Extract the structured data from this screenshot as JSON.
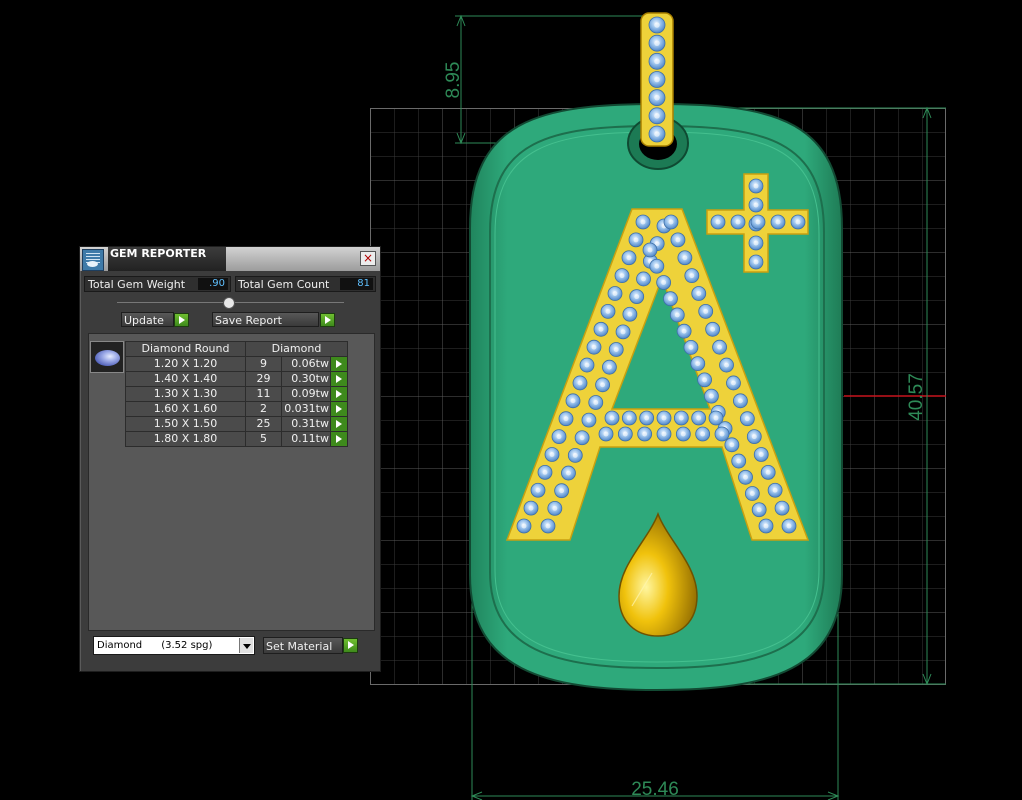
{
  "dimensions": {
    "top_height": "8.95",
    "right_height": "40.57",
    "bottom_width": "25.46"
  },
  "panel": {
    "title": "GEM REPORTER",
    "close_label": "×",
    "total_weight_label": "Total Gem Weight",
    "total_weight_value": ".90",
    "total_count_label": "Total Gem Count",
    "total_count_value": "81",
    "update_label": "Update",
    "save_report_label": "Save Report",
    "table": {
      "headers": [
        "Diamond Round",
        "Diamond"
      ],
      "rows": [
        {
          "size": "1.20 X 1.20",
          "count": "9",
          "weight": "0.06tw"
        },
        {
          "size": "1.40 X 1.40",
          "count": "29",
          "weight": "0.30tw"
        },
        {
          "size": "1.30 X 1.30",
          "count": "11",
          "weight": "0.09tw"
        },
        {
          "size": "1.60 X 1.60",
          "count": "2",
          "weight": "0.031tw"
        },
        {
          "size": "1.50 X 1.50",
          "count": "25",
          "weight": "0.31tw"
        },
        {
          "size": "1.80 X 1.80",
          "count": "5",
          "weight": "0.11tw"
        }
      ]
    },
    "material_select": "Diamond      (3.52 spg)",
    "set_material_label": "Set Material"
  },
  "colors": {
    "pendant_green": "#2da57a",
    "pendant_edge": "#1b6b4b",
    "gold": "#f2cc1e",
    "gem_blue": "#8fbde8",
    "dimension_green": "#2e8a57",
    "accent_button_green": "#4aa321"
  },
  "icons": [
    "gem-reporter-icon",
    "close-icon",
    "round-diamond-icon",
    "play-arrow-icon",
    "dropdown-arrow-icon"
  ]
}
